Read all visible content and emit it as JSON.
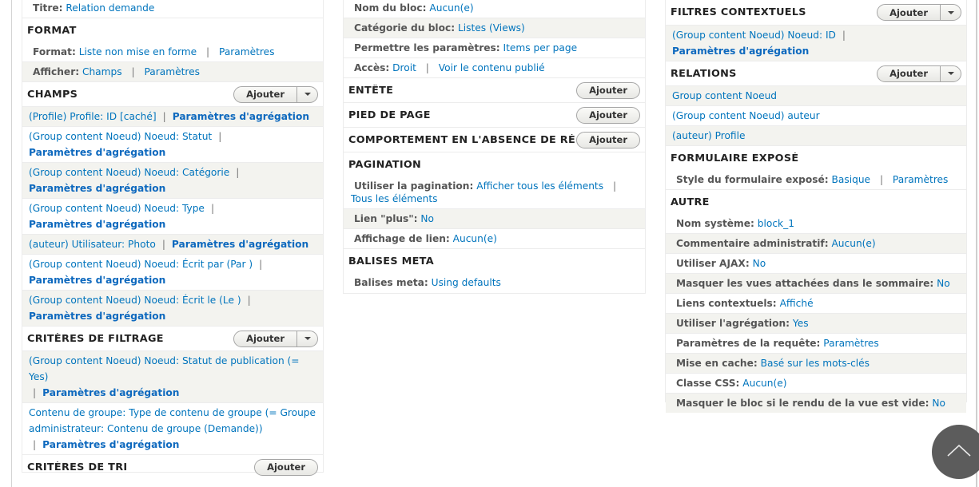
{
  "col1": {
    "titre": {
      "label": "Titre:",
      "value": "Relation demande"
    },
    "format": {
      "title": "FORMAT",
      "rows": [
        {
          "label": "Format:",
          "value": "Liste non mise en forme",
          "extra": "Paramètres"
        },
        {
          "label": "Afficher:",
          "value": "Champs",
          "extra": "Paramètres"
        }
      ]
    },
    "champs": {
      "title": "CHAMPS",
      "add_label": "Ajouter",
      "items": [
        {
          "text": "(Profile) Profile: ID [caché]",
          "agg": "Paramètres d'agrégation"
        },
        {
          "text": "(Group content Noeud) Noeud: Statut",
          "agg": "Paramètres d'agrégation"
        },
        {
          "text": "(Group content Noeud) Noeud: Catégorie",
          "agg": "Paramètres d'agrégation"
        },
        {
          "text": "(Group content Noeud) Noeud: Type",
          "agg": "Paramètres d'agrégation"
        },
        {
          "text": "(auteur) Utilisateur: Photo",
          "agg": "Paramètres d'agrégation"
        },
        {
          "text": "(Group content Noeud) Noeud: Écrit par (Par )",
          "agg": "Paramètres d'agrégation"
        },
        {
          "text": "(Group content Noeud) Noeud: Écrit le (Le )",
          "agg": "Paramètres d'agrégation"
        }
      ]
    },
    "filtrage": {
      "title": "CRITÈRES DE FILTRAGE",
      "add_label": "Ajouter",
      "items": [
        {
          "text": "(Group content Noeud) Noeud: Statut de publication (= Yes)",
          "agg": "Paramètres d'agrégation"
        },
        {
          "text": "Contenu de groupe: Type de contenu de groupe (= Groupe administrateur: Contenu de groupe (Demande))",
          "agg": "Paramètres d'agrégation"
        }
      ]
    },
    "tri": {
      "title": "CRITÈRES DE TRI",
      "add_label": "Ajouter"
    }
  },
  "col2": {
    "bloc_rows": [
      {
        "label": "Nom du bloc:",
        "value": "Aucun(e)"
      },
      {
        "label": "Catégorie du bloc:",
        "value": "Listes (Views)"
      },
      {
        "label": "Permettre les paramètres:",
        "value": "Items per page"
      },
      {
        "label": "Accès:",
        "value": "Droit",
        "extra": "Voir le contenu publié"
      }
    ],
    "entete": {
      "title": "ENTÊTE",
      "add_label": "Ajouter"
    },
    "pied": {
      "title": "PIED DE PAGE",
      "add_label": "Ajouter"
    },
    "absence": {
      "title": "COMPORTEMENT EN L'ABSENCE DE RÉSULTATS",
      "add_label": "Ajouter"
    },
    "pagination": {
      "title": "PAGINATION",
      "rows": [
        {
          "label": "Utiliser la pagination:",
          "value": "Afficher tous les éléments",
          "extra": "Tous les éléments"
        },
        {
          "label": "Lien \"plus\":",
          "value": "No"
        },
        {
          "label": "Affichage de lien:",
          "value": "Aucun(e)"
        }
      ]
    },
    "meta": {
      "title": "BALISES META",
      "rows": [
        {
          "label": "Balises meta:",
          "value": "Using defaults"
        }
      ]
    }
  },
  "col3": {
    "contextuels": {
      "title": "FILTRES CONTEXTUELS",
      "add_label": "Ajouter",
      "items": [
        {
          "text": "(Group content Noeud) Noeud: ID",
          "agg": "Paramètres d'agrégation"
        }
      ]
    },
    "relations": {
      "title": "RELATIONS",
      "add_label": "Ajouter",
      "items": [
        "Group content Noeud",
        "(Group content Noeud) auteur",
        "(auteur) Profile"
      ]
    },
    "expose": {
      "title": "FORMULAIRE EXPOSÉ",
      "rows": [
        {
          "label": "Style du formulaire exposé:",
          "value": "Basique",
          "extra": "Paramètres"
        }
      ]
    },
    "autre": {
      "title": "AUTRE",
      "rows": [
        {
          "label": "Nom système:",
          "value": "block_1"
        },
        {
          "label": "Commentaire administratif:",
          "value": "Aucun(e)"
        },
        {
          "label": "Utiliser AJAX:",
          "value": "No"
        },
        {
          "label": "Masquer les vues attachées dans le sommaire:",
          "value": "No"
        },
        {
          "label": "Liens contextuels:",
          "value": "Affiché"
        },
        {
          "label": "Utiliser l'agrégation:",
          "value": "Yes"
        },
        {
          "label": "Paramètres de la requête:",
          "value": "Paramètres"
        },
        {
          "label": "Mise en cache:",
          "value": "Basé sur les mots-clés"
        },
        {
          "label": "Classe CSS:",
          "value": "Aucun(e)"
        },
        {
          "label": "Masquer le bloc si le rendu de la vue est vide:",
          "value": "No"
        }
      ]
    }
  },
  "scroll_top": {
    "icon": "chevron-up-icon"
  },
  "separator": "|"
}
